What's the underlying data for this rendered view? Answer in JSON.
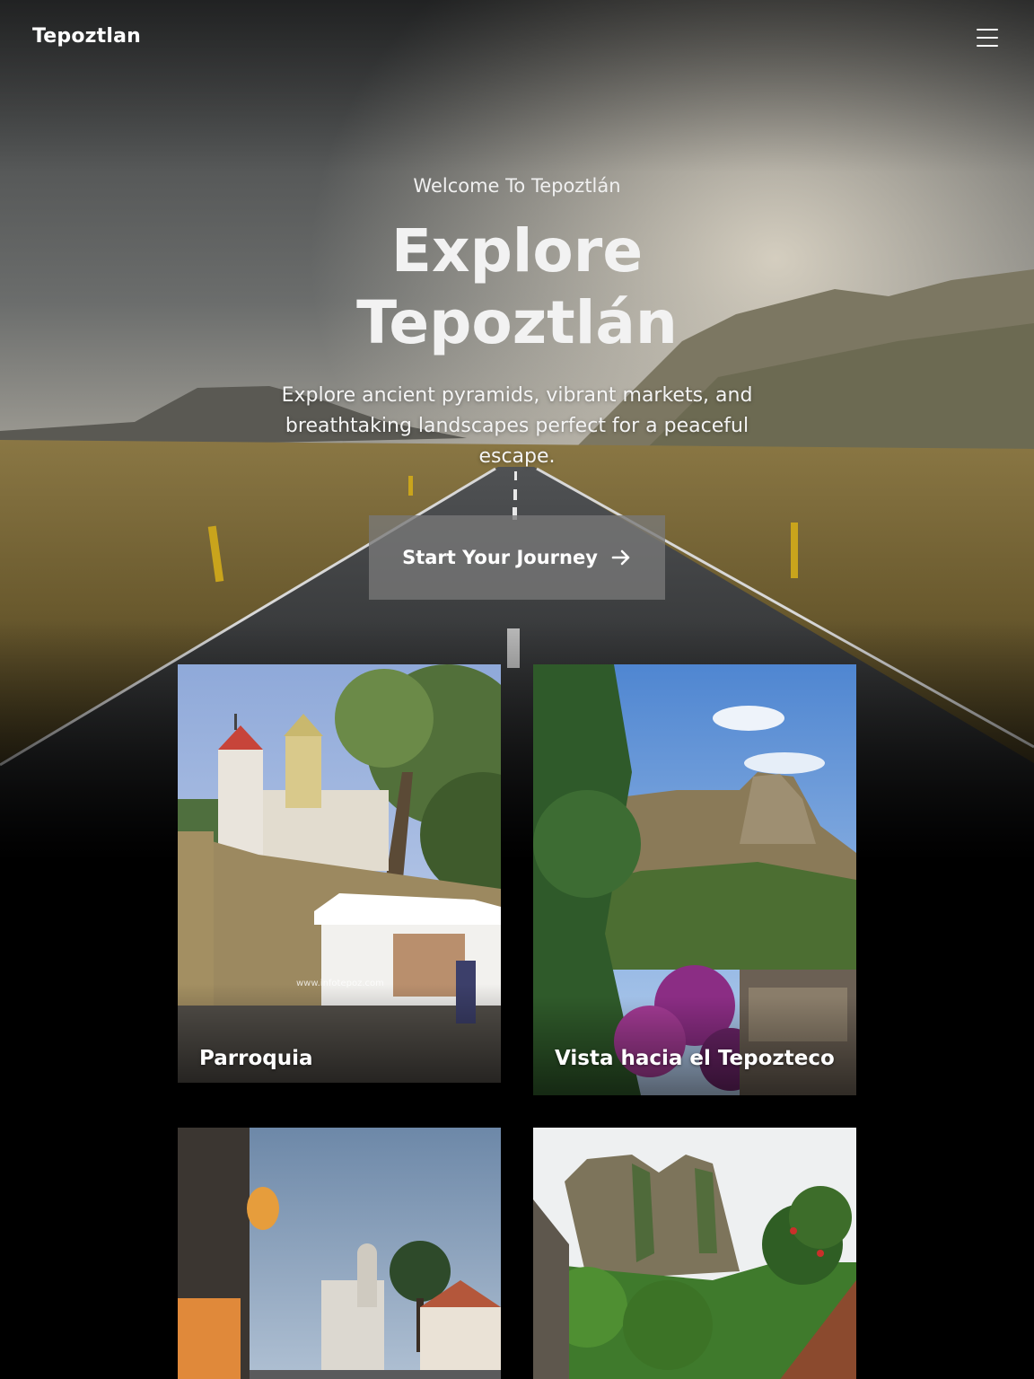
{
  "nav": {
    "brand": "Tepoztlan",
    "menu_icon": "hamburger-menu-icon"
  },
  "hero": {
    "eyebrow": "Welcome To Tepoztlán",
    "title_line1": "Explore",
    "title_line2": "Tepoztlán",
    "description": "Explore ancient pyramids, vibrant markets, and breathtaking landscapes perfect for a peaceful escape.",
    "cta_label": "Start Your Journey",
    "cta_icon": "arrow-right-icon"
  },
  "cards": [
    {
      "title": "Parroquia",
      "watermark": "www.infotepoz.com"
    },
    {
      "title": "Vista hacia el Tepozteco"
    },
    {
      "title": ""
    },
    {
      "title": ""
    }
  ],
  "colors": {
    "page_background": "#000000",
    "text": "#ffffff",
    "cta_background": "#787878"
  }
}
